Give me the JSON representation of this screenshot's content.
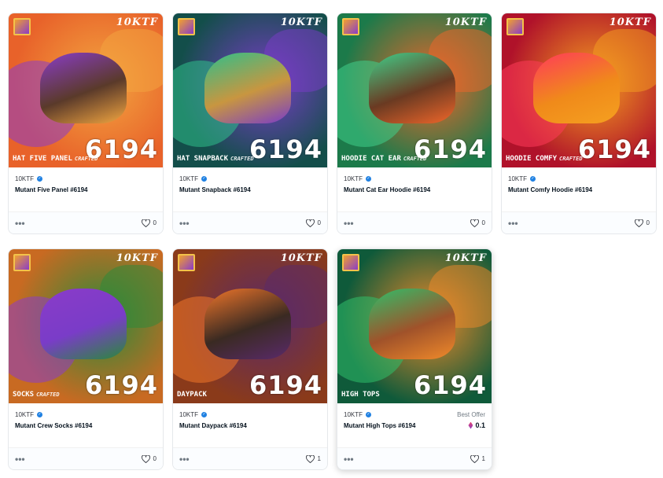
{
  "cards": [
    {
      "brand_logo": "10KTF",
      "art_number": "6194",
      "art_tag": "HAT FIVE PANEL",
      "art_crafted": "CRAFTED",
      "collection": "10KTF",
      "name": "Mutant Five Panel #6194",
      "likes": "0",
      "palette": {
        "bg": "#e8622a",
        "blob1": "#8a3cc8",
        "blob2": "#f3a640",
        "product": "#5a3a2a"
      }
    },
    {
      "brand_logo": "10KTF",
      "art_number": "6194",
      "art_tag": "HAT SNAPBACK",
      "art_crafted": "CRAFTED",
      "collection": "10KTF",
      "name": "Mutant Snapback #6194",
      "likes": "0",
      "palette": {
        "bg": "#134e4a",
        "blob1": "#2fbf8a",
        "blob2": "#7a3cc8",
        "product": "#c89640"
      }
    },
    {
      "brand_logo": "10KTF",
      "art_number": "6194",
      "art_tag": "HOODIE CAT EAR",
      "art_crafted": "CRAFTED",
      "collection": "10KTF",
      "name": "Mutant Cat Ear Hoodie #6194",
      "likes": "0",
      "palette": {
        "bg": "#1c7a4a",
        "blob1": "#3fd08a",
        "blob2": "#f0662a",
        "product": "#6a3a22"
      }
    },
    {
      "brand_logo": "10KTF",
      "art_number": "6194",
      "art_tag": "HOODIE COMFY",
      "art_crafted": "CRAFTED",
      "collection": "10KTF",
      "name": "Mutant Comfy Hoodie #6194",
      "likes": "0",
      "palette": {
        "bg": "#b0122a",
        "blob1": "#ff3a5a",
        "blob2": "#f5a020",
        "product": "#f08a1a"
      }
    },
    {
      "brand_logo": "10KTF",
      "art_number": "6194",
      "art_tag": "SOCKS",
      "art_crafted": "CRAFTED",
      "collection": "10KTF",
      "name": "Mutant Crew Socks #6194",
      "likes": "0",
      "palette": {
        "bg": "#c86a22",
        "blob1": "#8a3cc8",
        "blob2": "#2a8a3a",
        "product": "#7a3cc8"
      }
    },
    {
      "brand_logo": "10KTF",
      "art_number": "6194",
      "art_tag": "DAYPACK",
      "art_crafted": "",
      "collection": "10KTF",
      "name": "Mutant Daypack #6194",
      "likes": "1",
      "palette": {
        "bg": "#8a3a1a",
        "blob1": "#f0762a",
        "blob2": "#5a2a6a",
        "product": "#3a2a22"
      }
    },
    {
      "brand_logo": "10KTF",
      "art_number": "6194",
      "art_tag": "HIGH TOPS",
      "art_crafted": "",
      "collection": "10KTF",
      "name": "Mutant High Tops #6194",
      "likes": "1",
      "offer_label": "Best Offer",
      "offer_price": "0.1",
      "palette": {
        "bg": "#0f5a3a",
        "blob1": "#2fbf6a",
        "blob2": "#f08a2a",
        "product": "#a0522a"
      }
    }
  ],
  "icons": {
    "more": "more-icon",
    "heart": "heart-icon",
    "verified": "verified-badge-icon",
    "eth": "ethereum-icon"
  }
}
